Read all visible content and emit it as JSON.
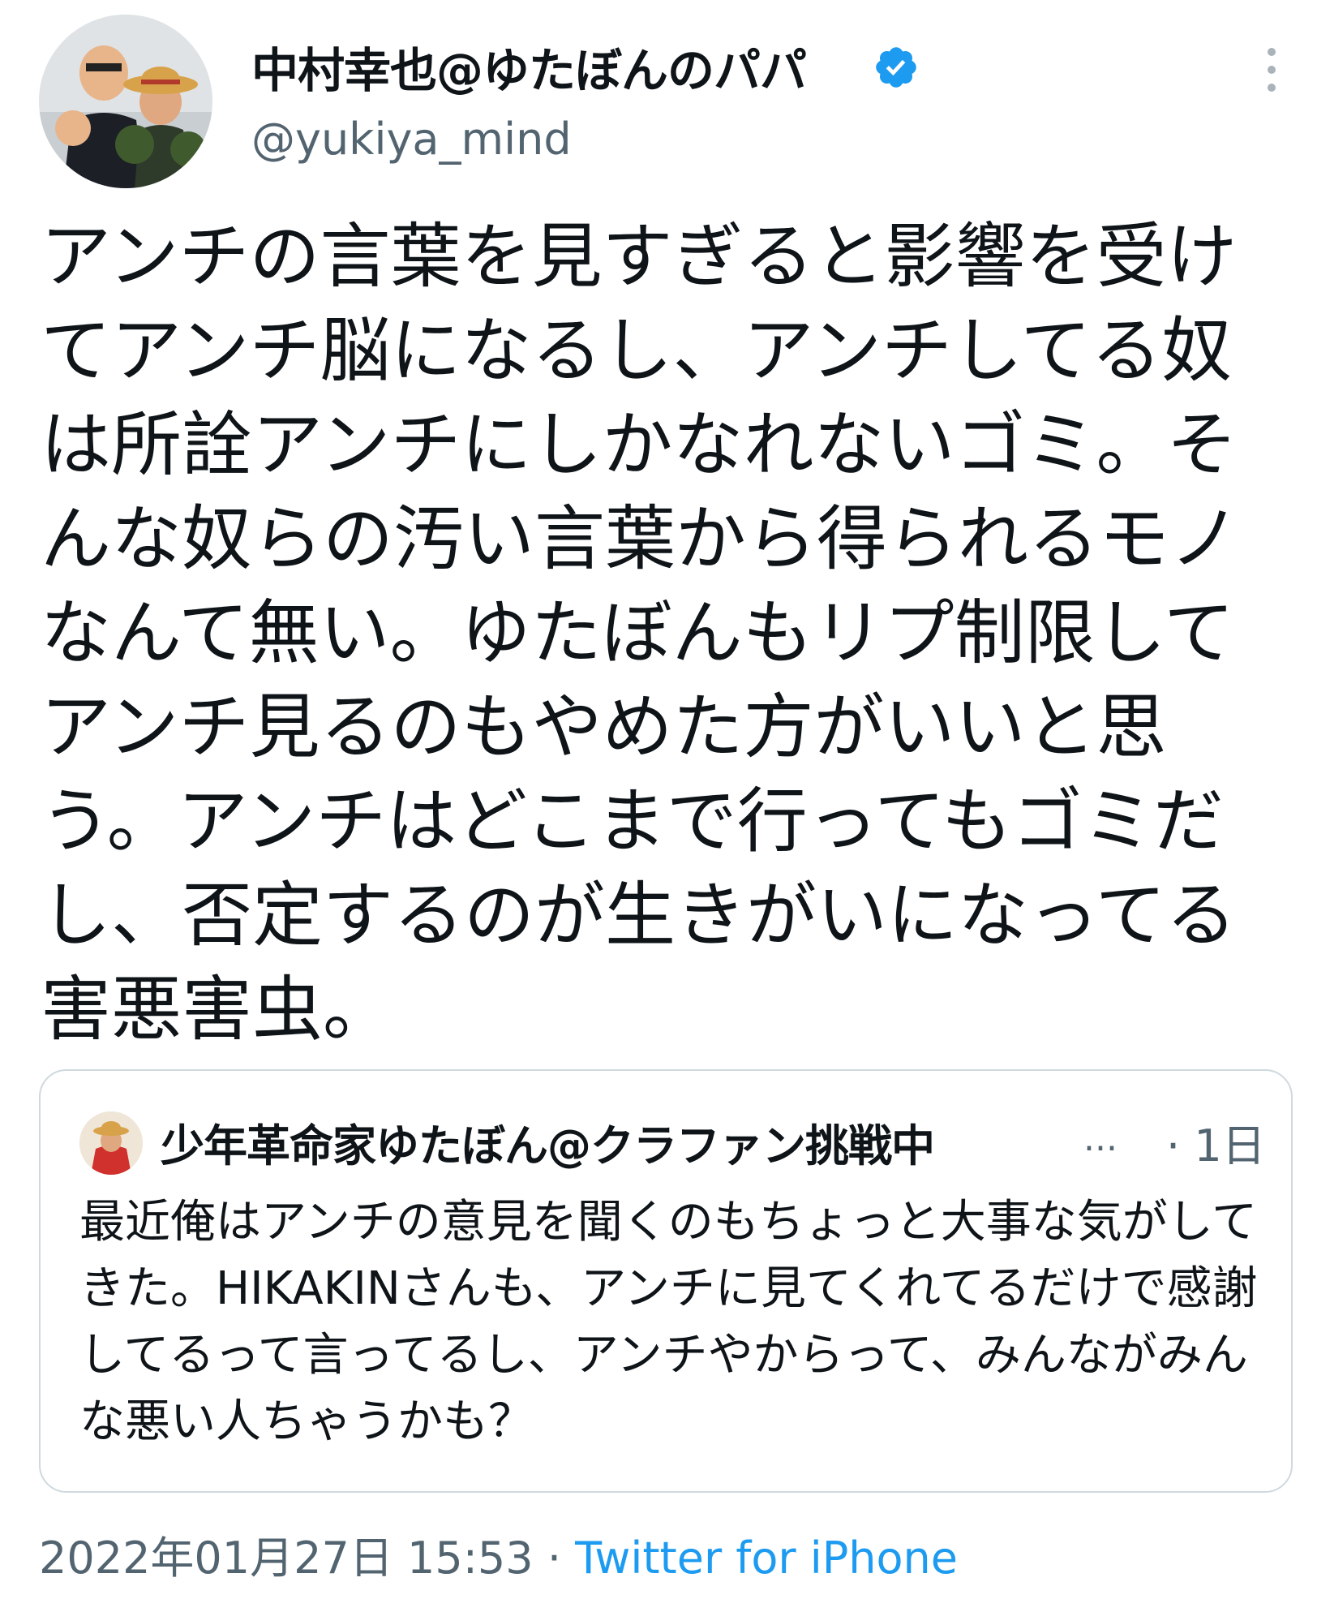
{
  "author": {
    "display_name": "中村幸也@ゆたぼんのパパ",
    "handle": "@yukiya_mind",
    "verified": true,
    "avatar_icon": "profile-photo"
  },
  "tweet": {
    "text": "アンチの言葉を見すぎると影響を受けてアンチ脳になるし、アンチしてる奴は所詮アンチにしかなれないゴミ。そんな奴らの汚い言葉から得られるモノなんて無い。ゆたぼんもリプ制限してアンチ見るのもやめた方がいいと思う。アンチはどこまで行ってもゴミだし、否定するのが生きがいになってる害悪害虫。",
    "date": "2022年01月27日 15:53",
    "separator": "·",
    "source": "Twitter for iPhone"
  },
  "quoted_tweet": {
    "display_name": "少年革命家ゆたぼん@クラファン挑戦中",
    "ellipsis": "...",
    "time": "· 1日",
    "text": "最近俺はアンチの意見を聞くのもちょっと大事な気がしてきた。HIKAKINさんも、アンチに見てくれてるだけで感謝してるって言ってるし、アンチやからって、みんながみんな悪い人ちゃうかも？"
  },
  "colors": {
    "text_primary": "#0f1419",
    "text_secondary": "#536471",
    "link": "#1d9bf0",
    "verified_badge": "#1d9bf0",
    "border": "#cfd9de"
  }
}
